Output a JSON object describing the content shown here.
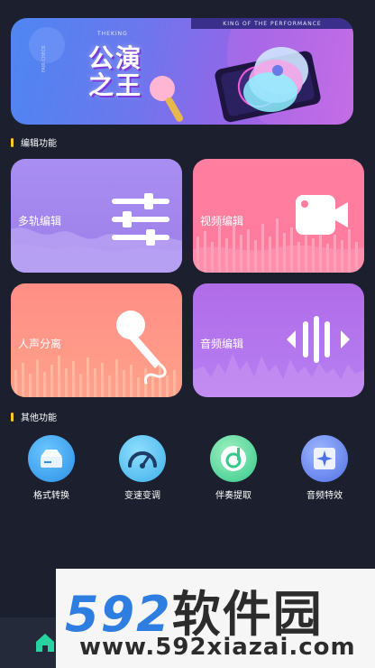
{
  "banner": {
    "top_strip": "KING OF THE PERFORMANCE",
    "sub": "THEKING",
    "title": "公演之王",
    "side_text": "FAIR CHECK"
  },
  "sections": {
    "edit": "编辑功能",
    "other": "其他功能"
  },
  "cards": [
    {
      "label": "多轨编辑",
      "icon": "sliders-icon"
    },
    {
      "label": "视频编辑",
      "icon": "video-camera-icon"
    },
    {
      "label": "人声分离",
      "icon": "microphone-icon"
    },
    {
      "label": "音频编辑",
      "icon": "audio-wave-icon"
    }
  ],
  "tools": [
    {
      "label": "格式转换",
      "icon": "format-convert-icon",
      "color": "#3ea3ee"
    },
    {
      "label": "变速变调",
      "icon": "speedometer-icon",
      "color": "#55c3f0"
    },
    {
      "label": "伴奏提取",
      "icon": "accompaniment-icon",
      "color": "#5bd89b"
    },
    {
      "label": "音频特效",
      "icon": "audio-effect-icon",
      "color": "#5f86ee"
    }
  ],
  "nav": {
    "home_icon": "home-icon",
    "home_color": "#27d3a0"
  },
  "watermark": {
    "brand_num": "592",
    "brand_cn": "软件园",
    "url": "www.592xiazai.com"
  }
}
